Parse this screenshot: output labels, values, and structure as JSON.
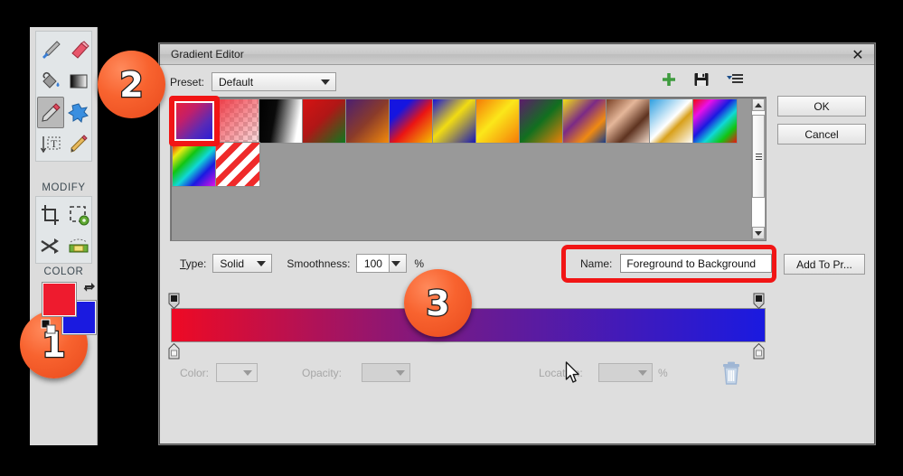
{
  "toolpanel": {
    "tools": [
      {
        "name": "brush-tool",
        "label": "Brush"
      },
      {
        "name": "eraser-tool",
        "label": "Eraser"
      },
      {
        "name": "paint-bucket-tool",
        "label": "Paint Bucket"
      },
      {
        "name": "gradient-tool",
        "label": "Gradient"
      },
      {
        "name": "eyedropper-tool",
        "label": "Eyedropper",
        "selected": true
      },
      {
        "name": "blob-tool",
        "label": "Blob"
      },
      {
        "name": "text-tool",
        "label": "Text"
      },
      {
        "name": "pencil-tool",
        "label": "Pencil"
      }
    ],
    "modify_label": "MODIFY",
    "modify_tools": [
      {
        "name": "crop-tool",
        "label": "Crop"
      },
      {
        "name": "transform-tool",
        "label": "Transform"
      },
      {
        "name": "flip-tool",
        "label": "Flip"
      },
      {
        "name": "perspective-tool",
        "label": "Perspective"
      }
    ],
    "color_label": "COLOR",
    "foreground_color": "#ee1b2e",
    "background_color": "#1a1ae0",
    "swap_icon": "swap-colors-icon",
    "default_icon": "default-colors-icon"
  },
  "dialog": {
    "title": "Gradient Editor",
    "close_label": "✕",
    "preset_label": "Preset:",
    "preset_value": "Default",
    "icons": [
      {
        "name": "add-preset-icon",
        "label": "+"
      },
      {
        "name": "save-preset-icon",
        "label": "Save"
      },
      {
        "name": "preset-menu-icon",
        "label": "Menu"
      }
    ],
    "ok_label": "OK",
    "cancel_label": "Cancel",
    "type_label": "Type:",
    "type_value": "Solid",
    "smoothness_label": "Smoothness:",
    "smoothness_value": "100",
    "percent_label": "%",
    "name_label": "Name:",
    "name_value": "Foreground to Background",
    "add_to_preset_label": "Add To Pr...",
    "color_label": "Color:",
    "opacity_label": "Opacity:",
    "location_label": "Location:",
    "location_percent": "%",
    "trash_icon": "delete-stop-icon",
    "gradient_start": "#ee0a24",
    "gradient_mid": "#6d1b8f",
    "gradient_end": "#1a1ae0",
    "swatches": [
      {
        "name": "foreground-to-background",
        "css": "linear-gradient(135deg,#f2212f 0%,#c21f6a 35%,#5b2ab5 65%,#1a1ae0 100%)"
      },
      {
        "name": "foreground-to-transparent",
        "css": "linear-gradient(135deg,#ef3b46 0%,rgba(239,59,70,0.15) 100%)",
        "checker": true
      },
      {
        "name": "black-to-white",
        "css": "linear-gradient(100deg,#000000 0%,#0a0a0a 35%,#ffffff 85%)"
      },
      {
        "name": "red-green",
        "css": "linear-gradient(135deg,#d61313 0%,#b01616 45%,#0a7a1e 100%)"
      },
      {
        "name": "violet-orange",
        "css": "linear-gradient(135deg,#4b1f72 0%,#8a3b2a 50%,#f58b0a 100%)"
      },
      {
        "name": "blue-red-yellow",
        "css": "linear-gradient(135deg,#1515e0 0%,#1515e0 25%,#ea1414 55%,#f5c400 100%)"
      },
      {
        "name": "blue-yellow-blue",
        "css": "linear-gradient(135deg,#1515d8 0%,#f2dc12 45%,#1515b8 100%)"
      },
      {
        "name": "orange-yellow-orange",
        "css": "linear-gradient(135deg,#f57a08 0%,#fbe71a 45%,#f57a08 100%)"
      },
      {
        "name": "violet-green-orange",
        "css": "linear-gradient(135deg,#5d1b6b 0%,#11701f 50%,#f08208 100%)"
      },
      {
        "name": "yellow-violet-orange-blue",
        "css": "linear-gradient(135deg,#f2e014 0%,#7b2a86 40%,#f08a12 70%,#123a8c 100%)"
      },
      {
        "name": "copper",
        "css": "linear-gradient(135deg,#7a4226 0%,#e5b79a 35%,#5e3320 65%,#f3ddcd 100%)"
      },
      {
        "name": "chrome",
        "css": "linear-gradient(135deg,#2f9fe0 0%,#ffffff 48%,#d8a01a 62%,#ffffff 100%)"
      },
      {
        "name": "spectrum",
        "css": "linear-gradient(135deg,#f20a0a 0%,#e810e8 22%,#1a1ae0 44%,#10d8d8 62%,#12c412 80%,#ef1111 100%)"
      },
      {
        "name": "transparent-rainbow",
        "css": "linear-gradient(135deg,#f20a0a 0%,#eaea12 18%,#12c412 36%,#10d8d8 54%,#1a1ae0 72%,#e810e8 100%)"
      },
      {
        "name": "transparent-stripes",
        "css": "repeating-linear-gradient(135deg,#ef2a2a 0 7px,#ffffff 7px 14px)",
        "checker": true
      }
    ]
  },
  "badges": [
    {
      "name": "step-badge-1",
      "label": "1"
    },
    {
      "name": "step-badge-2",
      "label": "2"
    },
    {
      "name": "step-badge-3",
      "label": "3"
    }
  ],
  "cursor": {
    "name": "mouse-cursor"
  }
}
